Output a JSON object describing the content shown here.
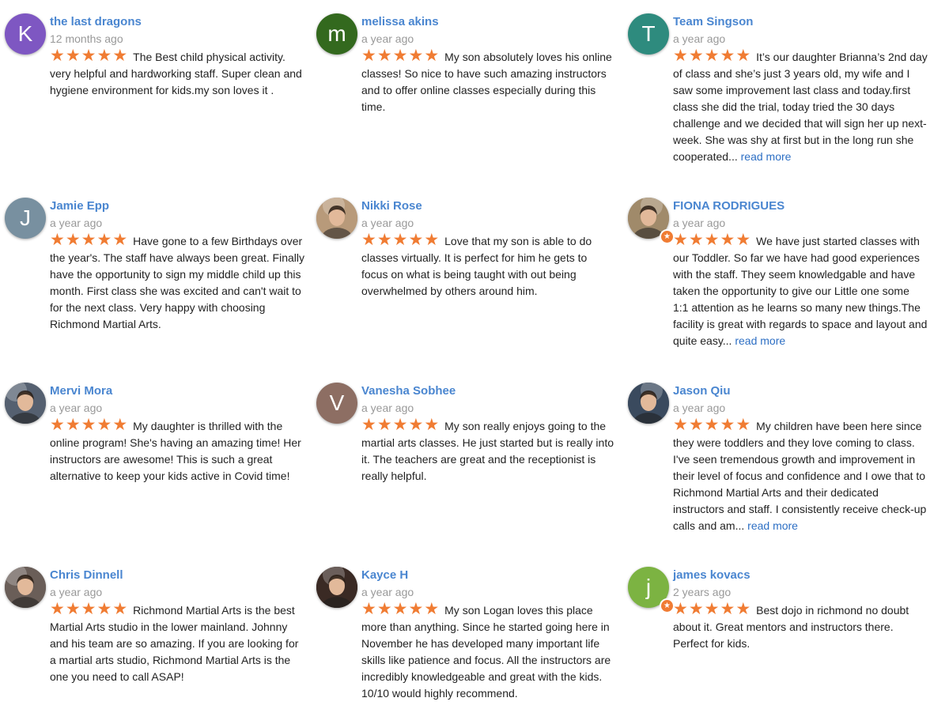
{
  "rating_color": "#f07c33",
  "name_color": "#4a86d0",
  "star_glyph": "★",
  "read_more_label": "read more",
  "reviews": [
    {
      "name": "the last dragons",
      "date": "12 months ago",
      "stars": 5,
      "avatar": {
        "type": "letter",
        "letter": "K",
        "color": "#7e57c2"
      },
      "text": "The Best child physical activity. very helpful and hardworking staff. Super clean and hygiene environment for kids.my son loves it .",
      "truncated": false
    },
    {
      "name": "melissa akins",
      "date": "a year ago",
      "stars": 5,
      "avatar": {
        "type": "letter",
        "letter": "m",
        "color": "#33691e"
      },
      "text": "My son absolutely loves his online classes! So nice to have such amazing instructors and to offer online classes especially during this time.",
      "truncated": false
    },
    {
      "name": "Team Singson",
      "date": "a year ago",
      "stars": 5,
      "avatar": {
        "type": "letter",
        "letter": "T",
        "color": "#2e8b7e"
      },
      "text": "It’s our daughter Brianna’s 2nd day of class and she’s just 3 years old, my wife and I saw some improvement last class and today.first class she did the trial, today tried the 30 days challenge and we decided that will sign her up next-week. She was shy at first but in the long run she cooperated...",
      "truncated": true
    },
    {
      "name": "Jamie Epp",
      "date": "a year ago",
      "stars": 5,
      "avatar": {
        "type": "letter",
        "letter": "J",
        "color": "#7890a0"
      },
      "text": "Have gone to a few Birthdays over the year's. The staff have always been great. Finally have the opportunity to sign my middle child up this month. First class she was excited and can't wait to for the next class. Very happy with choosing Richmond Martial Arts.",
      "truncated": false
    },
    {
      "name": "Nikki Rose",
      "date": "a year ago",
      "stars": 5,
      "avatar": {
        "type": "photo",
        "color": "#b89a7a"
      },
      "text": "Love that my son is able to do classes virtually. It is perfect for him he gets to focus on what is being taught with out being overwhelmed by others around him.",
      "truncated": false
    },
    {
      "name": "FIONA RODRIGUES",
      "date": "a year ago",
      "stars": 5,
      "avatar": {
        "type": "photo",
        "color": "#a08a6a",
        "badge": true
      },
      "text": "We have just started classes with our Toddler. So far we have had good experiences with the staff.  They seem knowledgable and have taken the opportunity to give our Little one some 1:1 attention as he learns so many new things.The facility is great with regards to space and layout and quite easy...",
      "truncated": true
    },
    {
      "name": "Mervi Mora",
      "date": "a year ago",
      "stars": 5,
      "avatar": {
        "type": "photo",
        "color": "#556070"
      },
      "text": "My daughter is thrilled with the online program!  She's having an amazing time!  Her instructors are awesome!  This is such a great alternative to keep your kids active in Covid time!",
      "truncated": false
    },
    {
      "name": "Vanesha Sobhee",
      "date": "a year ago",
      "stars": 5,
      "avatar": {
        "type": "letter",
        "letter": "V",
        "color": "#8d6e63"
      },
      "text": "My son really enjoys going to the martial arts classes.  He just started but is really into it. The teachers are great and the receptionist is really helpful.",
      "truncated": false
    },
    {
      "name": "Jason Qiu",
      "date": "a year ago",
      "stars": 5,
      "avatar": {
        "type": "photo",
        "color": "#3a4a5e"
      },
      "text": "My children have been here since they were toddlers and they love coming to class. I've seen tremendous growth and improvement in their level of focus and confidence and I owe that to Richmond Martial Arts and their dedicated instructors and staff. I consistently receive check-up calls and am...",
      "truncated": true
    },
    {
      "name": "Chris Dinnell",
      "date": "a year ago",
      "stars": 5,
      "avatar": {
        "type": "photo",
        "color": "#6a5e58"
      },
      "text": "Richmond Martial Arts is the best Martial Arts studio in the lower mainland. Johnny and his team are so amazing. If you are looking for a martial arts studio, Richmond Martial Arts is the one you need to call ASAP!",
      "truncated": false
    },
    {
      "name": "Kayce H",
      "date": "a year ago",
      "stars": 5,
      "avatar": {
        "type": "photo",
        "color": "#3a2a24"
      },
      "text": "My son Logan loves this place more than anything. Since he started going here in November he has developed many important life skills like patience and focus. All the instructors are incredibly knowledgeable and great with the kids. 10/10 would highly recommend.",
      "truncated": false
    },
    {
      "name": "james kovacs",
      "date": "2 years ago",
      "stars": 5,
      "avatar": {
        "type": "letter",
        "letter": "j",
        "color": "#7cb342",
        "badge": true
      },
      "text": "Best dojo in richmond no doubt about it. Great mentors and instructors there. Perfect for kids.",
      "truncated": false
    }
  ]
}
